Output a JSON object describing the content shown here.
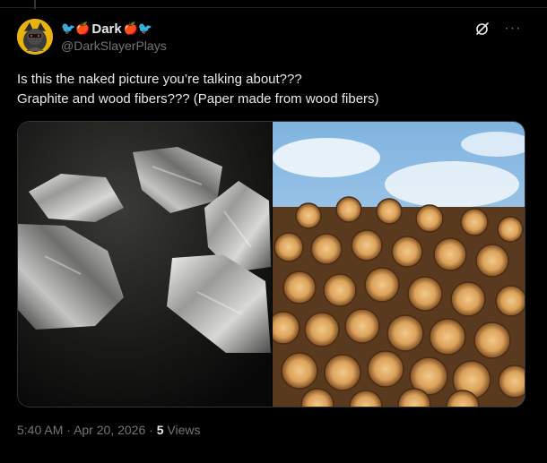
{
  "author": {
    "display_name": "Dark",
    "name_prefix_glyphs": "🐦🍎",
    "name_suffix_glyphs": "🍎🐦",
    "handle": "@DarkSlayerPlays"
  },
  "tweet": {
    "line1": "Is this the naked picture you’re talking about???",
    "line2": "Graphite and wood fibers??? (Paper made from wood fibers)"
  },
  "media": {
    "left_image": "graphite-chunks",
    "right_image": "stacked-logs"
  },
  "meta": {
    "time": "5:40 AM",
    "separator": "·",
    "date": "Apr 20, 2026",
    "views_count": "5",
    "views_label": "Views"
  },
  "icons": {
    "grok": "grok-icon",
    "more": "more-icon"
  },
  "colors": {
    "background": "#000000",
    "text_primary": "#e7e9ea",
    "text_secondary": "#71767b",
    "border": "#2f3336"
  }
}
